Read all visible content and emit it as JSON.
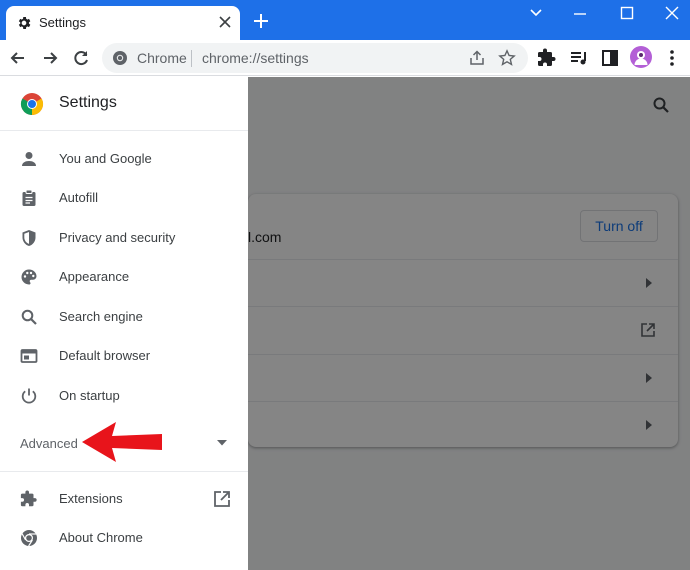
{
  "browser": {
    "tab_title": "Settings",
    "omnibox_site": "Chrome",
    "omnibox_url": "chrome://settings"
  },
  "drawer": {
    "title": "Settings",
    "items": [
      {
        "label": "You and Google",
        "icon": "person-icon"
      },
      {
        "label": "Autofill",
        "icon": "clipboard-icon"
      },
      {
        "label": "Privacy and security",
        "icon": "shield-icon"
      },
      {
        "label": "Appearance",
        "icon": "palette-icon"
      },
      {
        "label": "Search engine",
        "icon": "search-icon"
      },
      {
        "label": "Default browser",
        "icon": "browser-window-icon"
      },
      {
        "label": "On startup",
        "icon": "power-icon"
      }
    ],
    "advanced_label": "Advanced",
    "bottom_items": [
      {
        "label": "Extensions",
        "icon": "puzzle-icon"
      },
      {
        "label": "About Chrome",
        "icon": "chrome-icon"
      }
    ]
  },
  "background_page": {
    "email_fragment": "l.com",
    "turn_off_label": "Turn off"
  },
  "colors": {
    "tabstrip": "#1e70e8",
    "accent": "#1a73e8",
    "annotation_arrow": "#e8141b"
  }
}
